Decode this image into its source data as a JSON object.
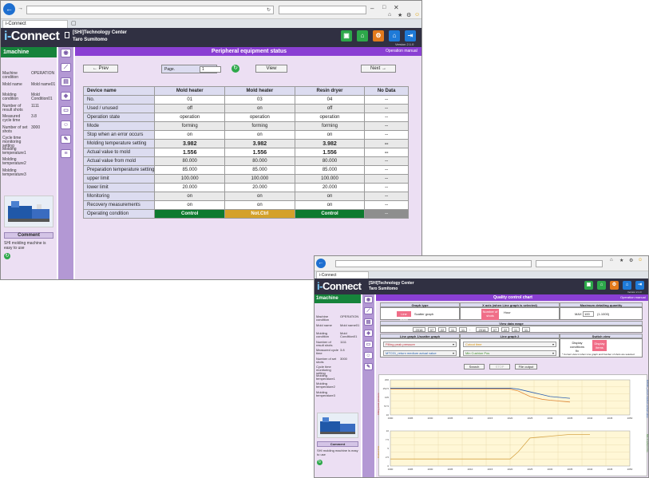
{
  "browser": {
    "tab_title": "i-Connect",
    "back_icon": "arrow-left-icon",
    "refresh_icon": "refresh-icon"
  },
  "header": {
    "logo_prefix": "i-",
    "logo_main": "Connect",
    "company": "[SHI]Technology Center",
    "user": "Taro Sumitomo",
    "version": "Version 2.1.0"
  },
  "left": {
    "machine": "1machine",
    "rows": [
      {
        "label": "Machine condition",
        "value": "OPERATION"
      },
      {
        "label": "Mold name",
        "value": "Mold name01"
      },
      {
        "label": "Molding condition",
        "value": "Mold Condition01"
      },
      {
        "label": "Number of result shots",
        "value": "1111"
      },
      {
        "label": "Measured cycle time",
        "value": "3.8"
      },
      {
        "label": "Number of set shots",
        "value": "3000"
      },
      {
        "label": "Cycle time monitoring setting",
        "value": ""
      },
      {
        "label": "Molding temperature1",
        "value": ""
      },
      {
        "label": "Molding temperature2",
        "value": ""
      },
      {
        "label": "Molding temperature3",
        "value": ""
      }
    ],
    "comment_header": "Comment",
    "comment_text": "SHI molding machine is easy to use"
  },
  "peripheral": {
    "title": "Peripheral equipment status",
    "operation_manual": "Operation manual",
    "prev": "← Prev",
    "page_label": "Page.",
    "page_value": "1",
    "page_unit": "▾",
    "view": "View",
    "next": "Next →",
    "columns": [
      "Device name",
      "Mold heater",
      "Mold heater",
      "Resin dryer",
      "No Data"
    ],
    "rows": [
      {
        "label": "No.",
        "cells": [
          "01",
          "03",
          "04",
          "--"
        ]
      },
      {
        "label": "Used / unused",
        "cells": [
          "off",
          "on",
          "off",
          "--"
        ]
      },
      {
        "label": "Operation state",
        "cells": [
          "operation",
          "operation",
          "operation",
          "--"
        ]
      },
      {
        "label": "Mode",
        "cells": [
          "forming",
          "forming",
          "forming",
          "--"
        ]
      },
      {
        "label": "Stop when an error occurs",
        "cells": [
          "on",
          "on",
          "on",
          "--"
        ]
      },
      {
        "label": "Molding temperature setting",
        "cells": [
          "3.982",
          "3.982",
          "3.982",
          "--"
        ],
        "big": true
      },
      {
        "label": "Actual value to mold",
        "cells": [
          "1.556",
          "1.556",
          "1.556",
          "--"
        ],
        "big": true
      },
      {
        "label": "Actual value from mold",
        "cells": [
          "80.000",
          "80.000",
          "80.000",
          "--"
        ]
      },
      {
        "label": "Preparation temperature setting",
        "cells": [
          "85.000",
          "85.000",
          "85.000",
          "--"
        ]
      },
      {
        "label": "upper limit",
        "cells": [
          "100.000",
          "100.000",
          "100.000",
          "--"
        ]
      },
      {
        "label": "lower limit",
        "cells": [
          "20.000",
          "20.000",
          "20.000",
          "--"
        ]
      },
      {
        "label": "Monitoring",
        "cells": [
          "on",
          "on",
          "on",
          "--"
        ]
      },
      {
        "label": "Recovery measurements",
        "cells": [
          "on",
          "on",
          "on",
          "--"
        ]
      },
      {
        "label": "Operating condition",
        "cells": [
          "Control",
          "Not.Ctrl",
          "Control",
          "--"
        ],
        "status": [
          "ctrl",
          "nctrl",
          "ctrl",
          "gray"
        ]
      }
    ]
  },
  "quality": {
    "title": "Quality control chart",
    "operation_manual": "Operation manual",
    "graph_type_hdr": "Graph type",
    "graph_type_line": "Line graph",
    "graph_type_scatter": "Scatter graph",
    "xaxis_hdr": "X axis (when Line graph is selected)",
    "xaxis_sel": "Number of shots",
    "xaxis_opt": "Hour",
    "maxqty_hdr": "Maximum detailing quantity",
    "maxqty_label": "MAX",
    "maxqty_value": "100",
    "maxqty_range": "(1-1000)",
    "range_hdr": "View data range",
    "range_from": [
      "2016",
      "07",
      "22",
      "11",
      "11"
    ],
    "range_sep": "-",
    "range_to": [
      "2016",
      "07",
      "22",
      "11",
      "11"
    ],
    "lg1_hdr": "Line graph 1/scatter graph",
    "lg1_a": "Filling peak pressure",
    "lg1_b": "MTC01_return medium actual value",
    "lg2_hdr": "Line graph 2",
    "lg2_a": "Cutout time",
    "lg2_b": "Min Cushion Pos",
    "switch_hdr": "Switch view",
    "switch_a": "Display conditions fix",
    "switch_b": "Display items",
    "switch_note": "* Current view is when Line graph and Number of shots are selected",
    "search": "Search",
    "stop": "STOP",
    "file": "File output",
    "chart1_ylabel_left": "Filling peak pressure",
    "chart1_ylabel_right": "MTC01_return medium actual value",
    "chart2_ylabel_left": "Cutout time",
    "chart2_ylabel_right": "Min Cushion Pos"
  },
  "chart_data": [
    {
      "type": "line",
      "title": "",
      "xlabel": "",
      "ylabel": "Filling peak pressure",
      "x": [
        1990,
        1995,
        2000,
        2005,
        2010,
        2015,
        2020,
        2022,
        2025,
        2028,
        2030,
        2035
      ],
      "xlim": [
        1990,
        2050
      ],
      "ylim": [
        10,
        200
      ],
      "series": [
        {
          "name": "Filling peak pressure",
          "values": [
            150,
            150,
            150,
            150,
            150,
            150,
            150,
            140,
            110,
            95,
            90,
            80
          ]
        },
        {
          "name": "MTC01_return medium actual value",
          "values": [
            155,
            155,
            155,
            155,
            155,
            155,
            155,
            150,
            135,
            120,
            110,
            100
          ]
        }
      ]
    },
    {
      "type": "line",
      "title": "",
      "xlabel": "",
      "ylabel": "Cutout time",
      "x": [
        1990,
        2000,
        2010,
        2015,
        2020,
        2022,
        2025,
        2030,
        2035,
        2040
      ],
      "xlim": [
        1990,
        2050
      ],
      "ylim": [
        0,
        10
      ],
      "series": [
        {
          "name": "Min Cushion Pos",
          "values": [
            2,
            2,
            2,
            2,
            2,
            4,
            8,
            8.5,
            9,
            9
          ]
        }
      ]
    }
  ]
}
